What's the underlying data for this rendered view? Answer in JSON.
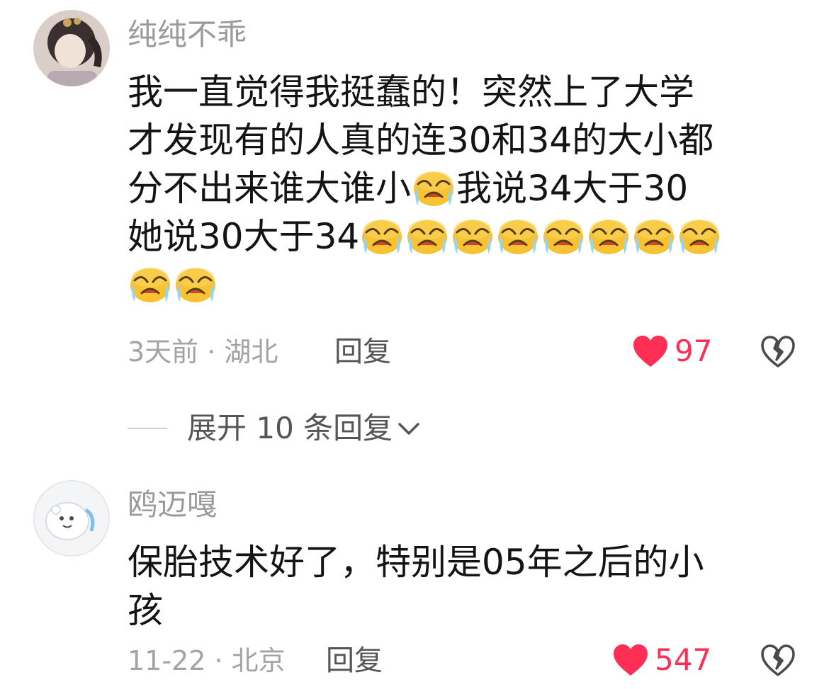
{
  "comments": [
    {
      "username": "纯纯不乖",
      "lines": [
        "我一直觉得我挺蠢的！突然上了大学",
        "才发现有的人真的连30和34的大小都",
        "分不出来谁大谁小",
        "我说34大于30",
        "她说30大于34"
      ],
      "emoji": "crying-face",
      "meta": "3天前 · 湖北",
      "reply_label": "回复",
      "likes": "97"
    },
    {
      "username": "鸥迈嘎",
      "lines": [
        "保胎技术好了，特别是05年之后的小",
        "孩"
      ],
      "meta": "11-22 · 北京",
      "reply_label": "回复",
      "likes": "547"
    }
  ],
  "expand": {
    "label": "展开 10 条回复"
  },
  "colors": {
    "like": "#ff2e55",
    "username": "#9a9a9a",
    "text": "#141414",
    "meta": "#a3a3a3"
  },
  "icons": {
    "like": "heart-icon",
    "dislike": "broken-heart-icon",
    "expand": "chevron-down-icon"
  }
}
